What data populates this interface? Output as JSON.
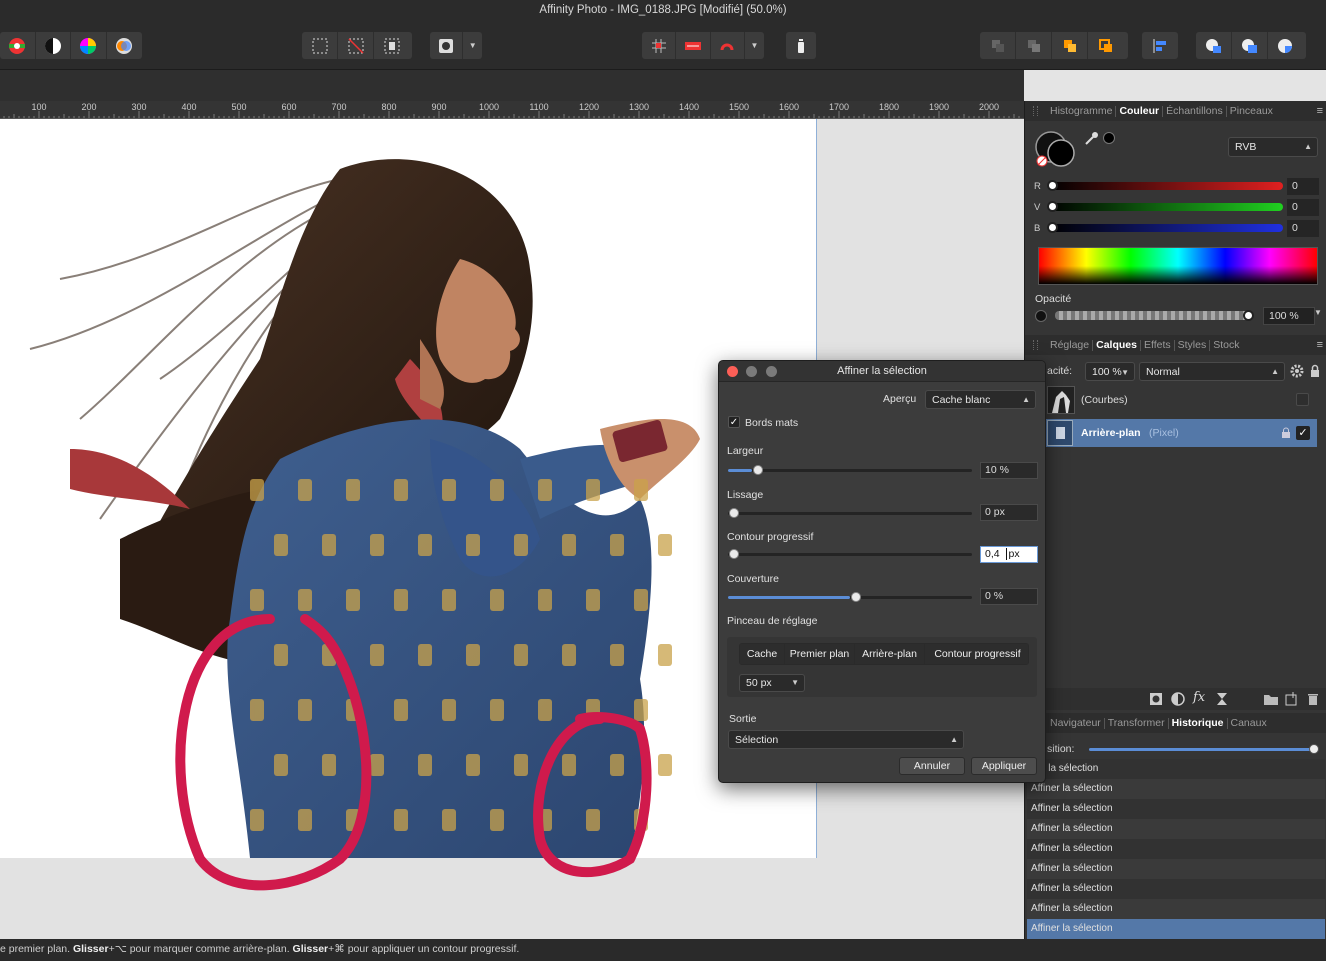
{
  "window": {
    "title": "Affinity Photo - IMG_0188.JPG [Modifié] (50.0%)"
  },
  "ruler": {
    "ticks": [
      "100",
      "200",
      "300",
      "400",
      "500",
      "600",
      "700",
      "800",
      "900",
      "1000",
      "1100",
      "1200",
      "1300",
      "1400",
      "1500",
      "1600",
      "1700",
      "1800",
      "1900",
      "2000"
    ]
  },
  "status": {
    "part1": "e premier plan. ",
    "glisser1": "Glisser",
    "part2": "+⌥ pour marquer comme arrière-plan. ",
    "glisser2": "Glisser",
    "part3": "+⌘ pour appliquer un contour progressif."
  },
  "color_panel": {
    "tabs": [
      "Histogramme",
      "Couleur",
      "Échantillons",
      "Pinceaux"
    ],
    "active_tab": "Couleur",
    "mode": "RVB",
    "channels": [
      {
        "label": "R",
        "value": "0",
        "color": "#e02020"
      },
      {
        "label": "V",
        "value": "0",
        "color": "#20d020"
      },
      {
        "label": "B",
        "value": "0",
        "color": "#2030e0"
      }
    ],
    "opacity_label": "Opacité",
    "opacity_value": "100 %"
  },
  "layers_panel": {
    "tabs": [
      "Réglage",
      "Calques",
      "Effets",
      "Styles",
      "Stock"
    ],
    "active_tab": "Calques",
    "opacity_label": "acité:",
    "opacity_value": "100 %",
    "blend_mode": "Normal",
    "layers": [
      {
        "name": "(Courbes)",
        "type": "",
        "selected": false
      },
      {
        "name": "Arrière-plan",
        "type": "(Pixel)",
        "selected": true
      }
    ]
  },
  "history_panel": {
    "tabs": [
      "Navigateur",
      "Transformer",
      "Historique",
      "Canaux"
    ],
    "active_tab": "Historique",
    "position_label": "sition:",
    "items": [
      "ner la sélection",
      "Affiner la sélection",
      "Affiner la sélection",
      "Affiner la sélection",
      "Affiner la sélection",
      "Affiner la sélection",
      "Affiner la sélection",
      "Affiner la sélection",
      "Affiner la sélection"
    ],
    "selected_index": 8
  },
  "dialog": {
    "title": "Affiner la sélection",
    "apercu_label": "Aperçu",
    "apercu_value": "Cache blanc",
    "bords_mats_label": "Bords mats",
    "bords_mats_checked": true,
    "largeur_label": "Largeur",
    "largeur_value": "10 %",
    "largeur_fraction": 0.1,
    "lissage_label": "Lissage",
    "lissage_value": "0 px",
    "lissage_fraction": 0,
    "contour_label": "Contour progressif",
    "contour_number": "0,4",
    "contour_unit": "px",
    "contour_fraction": 0,
    "couverture_label": "Couverture",
    "couverture_value": "0 %",
    "couverture_fraction": 0.5,
    "pinceau_label": "Pinceau de réglage",
    "brush_modes": [
      "Cache",
      "Premier plan",
      "Arrière-plan",
      "Contour progressif"
    ],
    "brush_size": "50 px",
    "sortie_label": "Sortie",
    "sortie_value": "Sélection",
    "cancel_label": "Annuler",
    "apply_label": "Appliquer"
  }
}
